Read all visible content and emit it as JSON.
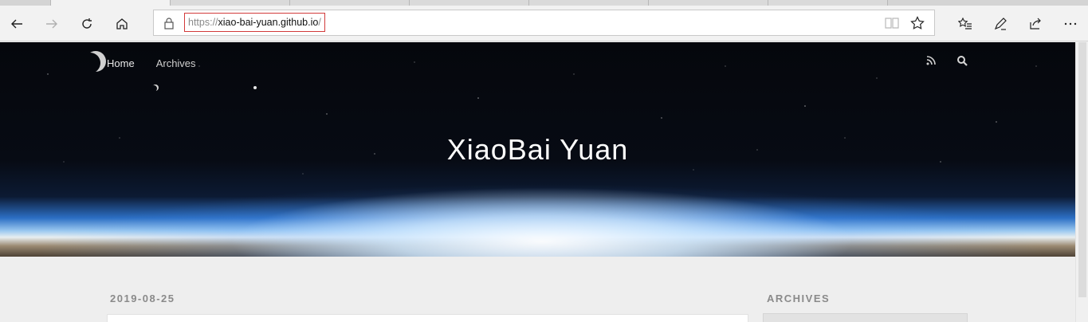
{
  "browser": {
    "address_bar": {
      "url_scheme": "https://",
      "url_host": "xiao-bai-yuan.github.io",
      "url_path": "/"
    }
  },
  "site": {
    "nav": [
      {
        "label": "Home"
      },
      {
        "label": "Archives"
      }
    ],
    "title": "XiaoBai Yuan"
  },
  "content": {
    "post_date": "2019-08-25",
    "sidebar_title": "ARCHIVES"
  }
}
